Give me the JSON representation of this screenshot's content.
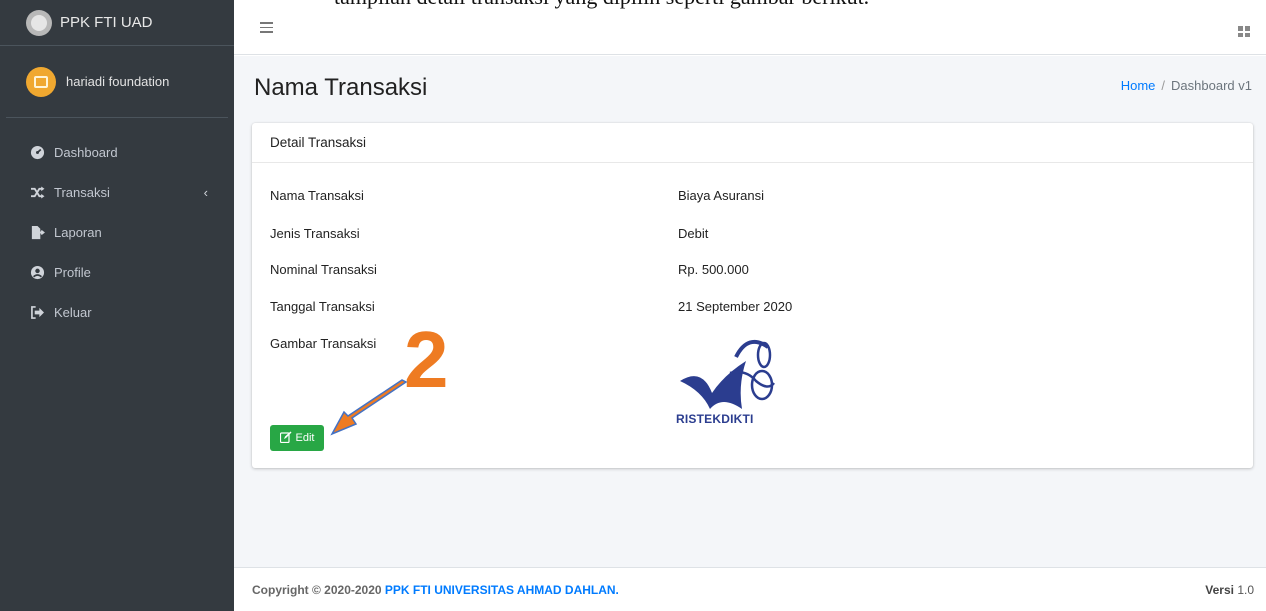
{
  "doc_caption": "tampilan detail transaksi yang dipilih seperti gambar berikut.",
  "brand": {
    "title": "PPK FTI UAD"
  },
  "user": {
    "name": "hariadi foundation"
  },
  "sidebar": {
    "items": [
      {
        "label": "Dashboard",
        "icon": "dashboard-icon"
      },
      {
        "label": "Transaksi",
        "icon": "shuffle-icon"
      },
      {
        "label": "Laporan",
        "icon": "file-export-icon"
      },
      {
        "label": "Profile",
        "icon": "user-circle-icon"
      },
      {
        "label": "Keluar",
        "icon": "sign-out-icon"
      }
    ]
  },
  "header": {
    "title": "Nama Transaksi",
    "breadcrumb": [
      "Home",
      "Dashboard v1"
    ]
  },
  "card": {
    "title": "Detail Transaksi",
    "rows": [
      {
        "label": "Nama Transaksi",
        "value": "Biaya Asuransi"
      },
      {
        "label": "Jenis Transaksi",
        "value": "Debit"
      },
      {
        "label": "Nominal Transaksi",
        "value": "Rp. 500.000"
      },
      {
        "label": "Tanggal Transaksi",
        "value": "21 September 2020"
      },
      {
        "label": "Gambar Transaksi",
        "value": ""
      }
    ],
    "image_text": "RISTEKDIKTI",
    "edit_label": "Edit"
  },
  "annotation": {
    "number": "2",
    "color": "#ee7b22"
  },
  "footer": {
    "copyright_prefix": "Copyright © 2020-2020 ",
    "copyright_brand": "PPK FTI UNIVERSITAS AHMAD DAHLAN.",
    "version_label": "Versi",
    "version_number": "1.0"
  },
  "colors": {
    "sidebar": "#343a40",
    "primary": "#007bff",
    "success": "#28a745"
  }
}
